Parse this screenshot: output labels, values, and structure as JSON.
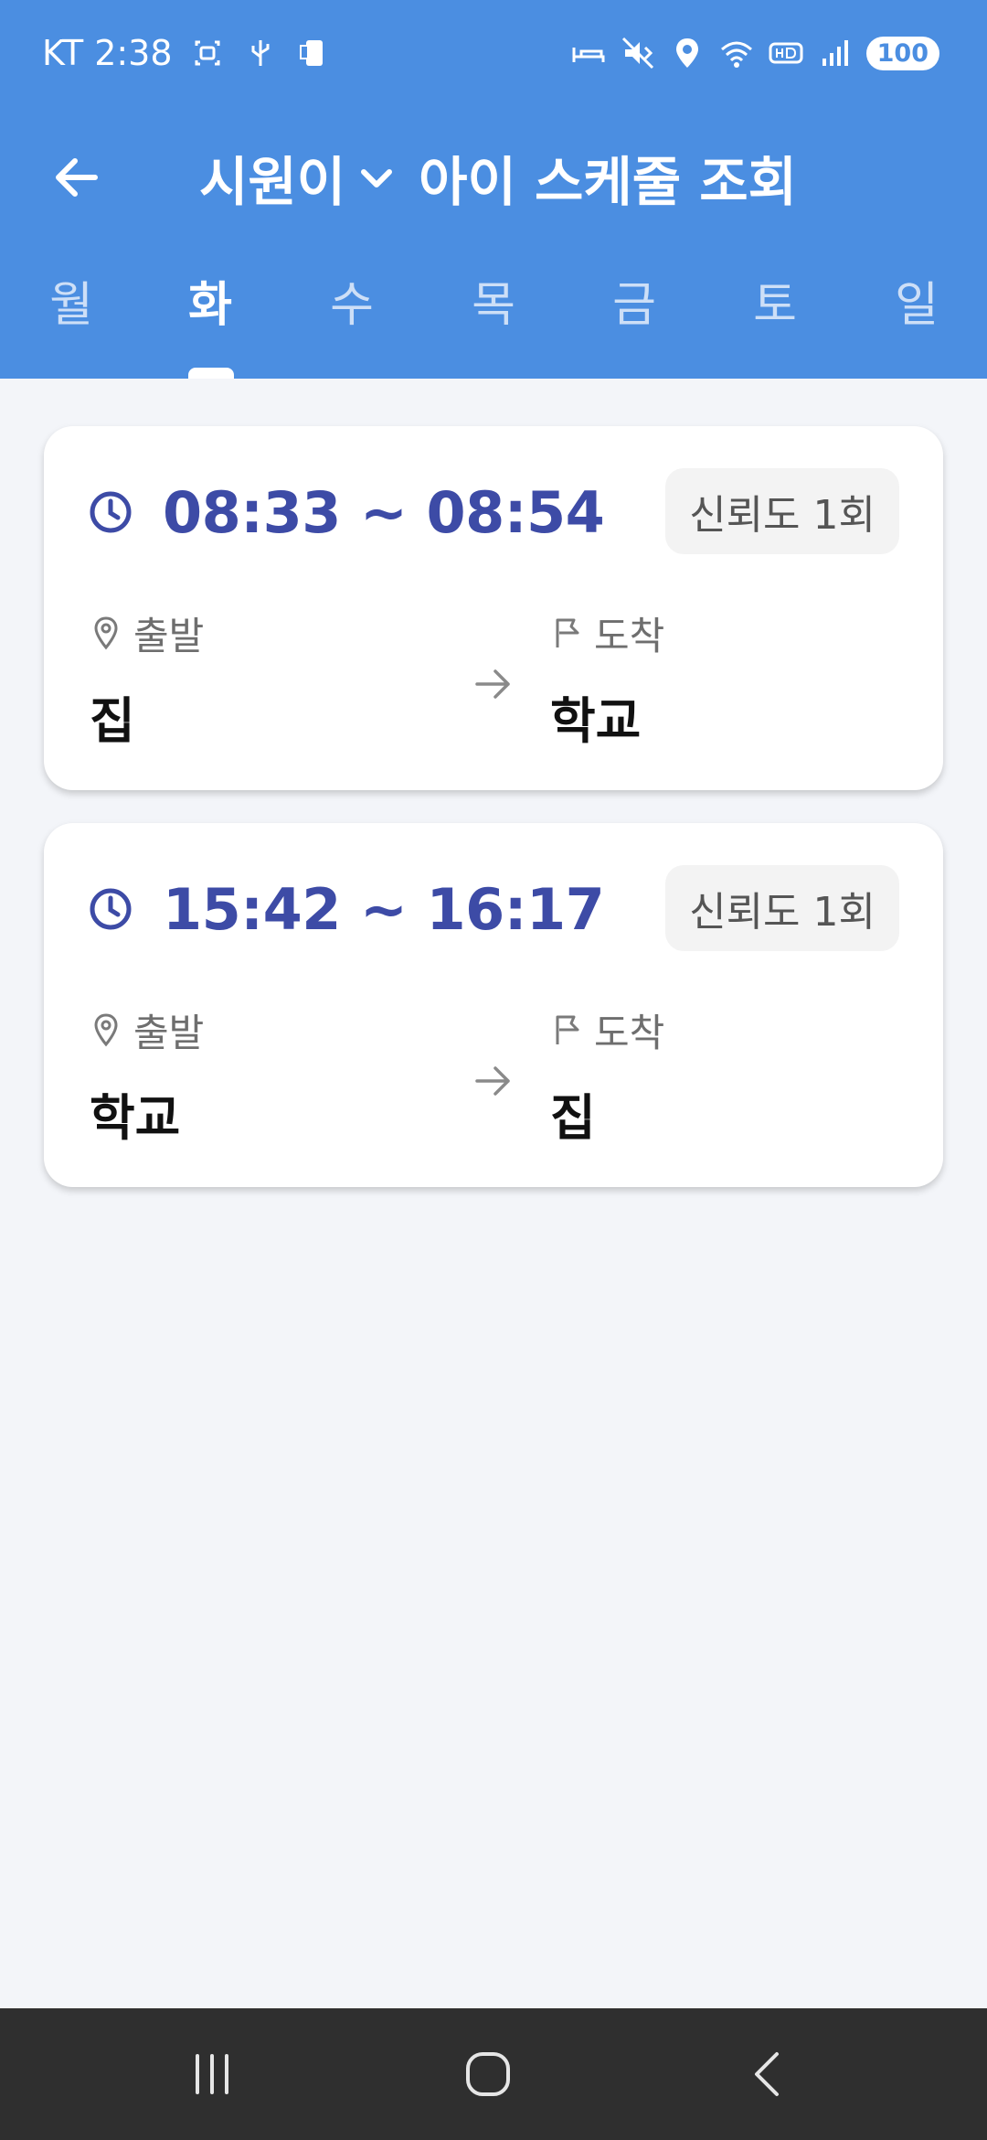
{
  "status_bar": {
    "carrier": "KT",
    "time": "2:38",
    "battery": "100"
  },
  "header": {
    "child_name": "시원이",
    "title": "아이 스케줄 조회"
  },
  "days": [
    "월",
    "화",
    "수",
    "목",
    "금",
    "토",
    "일"
  ],
  "selected_day": "화",
  "schedules": [
    {
      "time": "08:33 ~ 08:54",
      "reliability": "신뢰도 1회",
      "from_label": "출발",
      "from": "집",
      "to_label": "도착",
      "to": "학교"
    },
    {
      "time": "15:42 ~ 16:17",
      "reliability": "신뢰도 1회",
      "from_label": "출발",
      "from": "학교",
      "to_label": "도착",
      "to": "집"
    }
  ],
  "colors": {
    "primary": "#4b8ee1",
    "time_text": "#3d4ba6",
    "background": "#f3f5f9"
  }
}
